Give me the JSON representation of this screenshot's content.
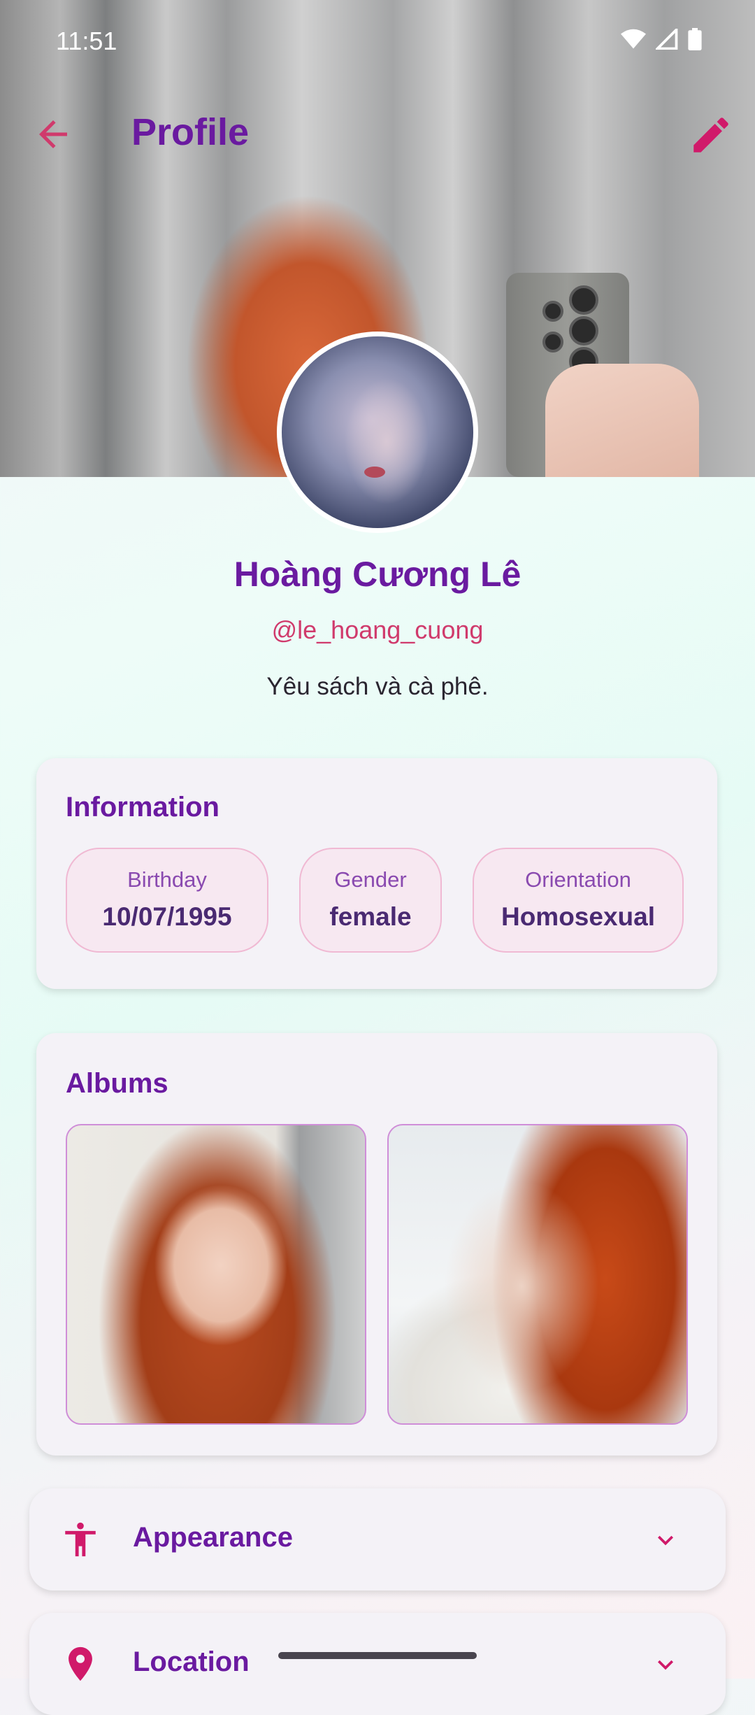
{
  "status_bar": {
    "time": "11:51"
  },
  "app_bar": {
    "title": "Profile"
  },
  "profile": {
    "name": "Hoàng Cương Lê",
    "handle": "@le_hoang_cuong",
    "bio": "Yêu sách và cà phê."
  },
  "information": {
    "title": "Information",
    "items": [
      {
        "label": "Birthday",
        "value": "10/07/1995"
      },
      {
        "label": "Gender",
        "value": "female"
      },
      {
        "label": "Orientation",
        "value": "Homosexual"
      }
    ]
  },
  "albums": {
    "title": "Albums"
  },
  "sections": [
    {
      "label": "Appearance",
      "icon": "accessibility-icon"
    },
    {
      "label": "Location",
      "icon": "location-pin-icon"
    }
  ],
  "colors": {
    "primary": "#6a1aa0",
    "accent": "#d03a6c",
    "chip_border": "#f0b9d3",
    "card_bg": "#f4f2f7"
  }
}
